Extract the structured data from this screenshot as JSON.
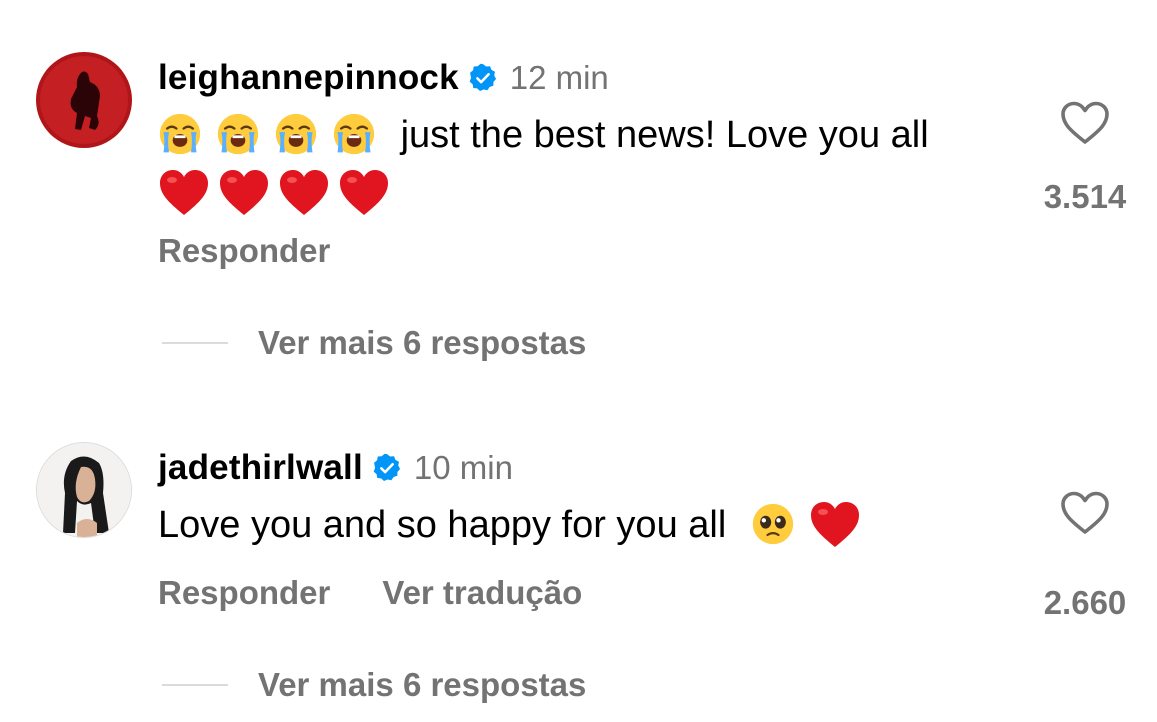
{
  "comments": [
    {
      "username": "leighannepinnock",
      "time": "12 min",
      "text": "just the best news! Love you all",
      "reply_label": "Responder",
      "more_replies_label": "Ver mais 6 respostas",
      "likes": "3.514",
      "emojis_before": [
        "loudly-crying-face",
        "loudly-crying-face",
        "loudly-crying-face",
        "loudly-crying-face"
      ],
      "emojis_after": [
        "red-heart",
        "red-heart",
        "red-heart",
        "red-heart"
      ]
    },
    {
      "username": "jadethirlwall",
      "time": "10 min",
      "text": "Love you and so happy for you all",
      "reply_label": "Responder",
      "translate_label": "Ver tradução",
      "more_replies_label": "Ver mais 6 respostas",
      "likes": "2.660",
      "emojis_after": [
        "pleading-face",
        "red-heart"
      ]
    }
  ],
  "colors": {
    "verified": "#0095f6",
    "secondary_text": "#737373",
    "heart_emoji": "#e0151f"
  }
}
